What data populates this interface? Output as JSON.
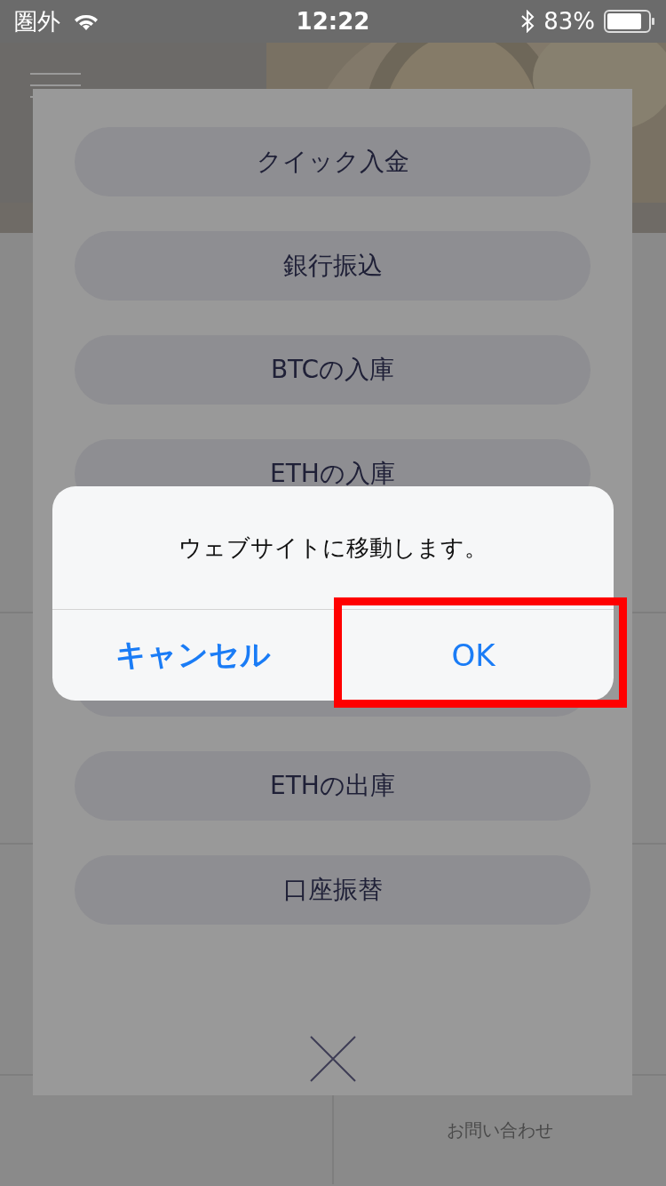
{
  "status_bar": {
    "carrier": "圏外",
    "time": "12:22",
    "battery_text": "83%"
  },
  "background": {
    "contact_label": "お問い合わせ"
  },
  "menu": {
    "items": [
      {
        "kind": "button",
        "label": "クイック入金"
      },
      {
        "kind": "button",
        "label": "銀行振込"
      },
      {
        "kind": "button",
        "label": "BTCの入庫"
      },
      {
        "kind": "button",
        "label": "ETHの入庫"
      },
      {
        "kind": "blank"
      },
      {
        "kind": "covered"
      },
      {
        "kind": "button",
        "label": "ETHの出庫"
      },
      {
        "kind": "button",
        "label": "口座振替"
      }
    ]
  },
  "alert": {
    "message": "ウェブサイトに移動します。",
    "buttons": [
      {
        "kind": "cancel",
        "label": "キャンセル",
        "highlighted": false
      },
      {
        "kind": "confirm",
        "label": "OK",
        "highlighted": true
      }
    ]
  }
}
